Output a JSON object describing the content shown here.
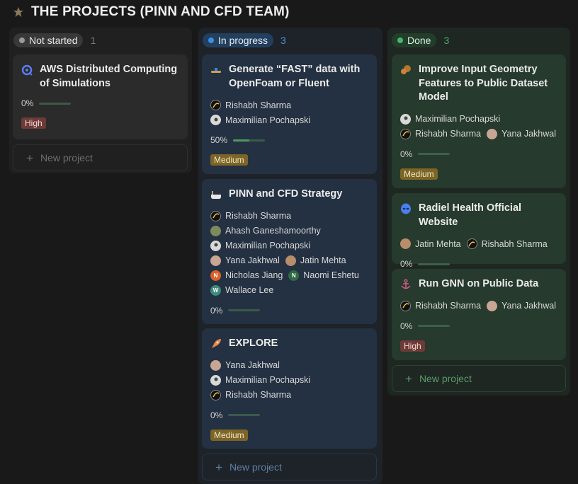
{
  "page": {
    "title": "THE PROJECTS (PINN AND CFD TEAM)"
  },
  "columns": {
    "not_started": {
      "label": "Not started",
      "count": "1",
      "cards": [
        {
          "title": "AWS Distributed Computing of Simulations",
          "icon": "gear-icon",
          "progress": "0%",
          "progress_fraction": 0,
          "priority": "High"
        }
      ],
      "new_label": "New project"
    },
    "in_progress": {
      "label": "In progress",
      "count": "3",
      "cards": [
        {
          "title": "Generate “FAST” data with OpenFoam or Fluent",
          "icon": "hammer-icon",
          "people": [
            "Rishabh Sharma",
            "Maximilian Pochapski"
          ],
          "progress": "50%",
          "progress_fraction": 0.5,
          "priority": "Medium"
        },
        {
          "title": "PINN and CFD Strategy",
          "icon": "bathtub-icon",
          "people": [
            "Rishabh Sharma",
            "Ahash Ganeshamoorthy",
            "Maximilian Pochapski",
            "Yana Jakhwal",
            "Jatin Mehta",
            "Nicholas Jiang",
            "Naomi Eshetu",
            "Wallace Lee"
          ],
          "initials": {
            "nj": "N",
            "ne": "N",
            "wl": "W"
          },
          "progress": "0%",
          "progress_fraction": 0
        },
        {
          "title": "EXPLORE",
          "icon": "rocket-icon",
          "people": [
            "Yana Jakhwal",
            "Maximilian Pochapski",
            "Rishabh Sharma"
          ],
          "progress": "0%",
          "progress_fraction": 0,
          "priority": "Medium"
        }
      ],
      "new_label": "New project"
    },
    "done": {
      "label": "Done",
      "count": "3",
      "cards": [
        {
          "title": "Improve Input Geometry Features to Public Dataset Model",
          "icon": "squirrel-icon",
          "people": [
            "Maximilian Pochapski",
            "Rishabh Sharma",
            "Yana Jakhwal"
          ],
          "progress": "0%",
          "progress_fraction": 0,
          "priority": "Medium"
        },
        {
          "title": "Radiel Health Official Website",
          "icon": "alien-icon",
          "people": [
            "Jatin Mehta",
            "Rishabh Sharma"
          ],
          "progress": "0%",
          "progress_fraction": 0
        },
        {
          "title": "Run GNN on Public Data",
          "icon": "anchor-icon",
          "people": [
            "Rishabh Sharma",
            "Yana Jakhwal"
          ],
          "progress": "0%",
          "progress_fraction": 0,
          "priority": "High"
        }
      ],
      "new_label": "New project"
    }
  },
  "colors": {
    "high": "#6e3a37",
    "medium": "#7c6526",
    "progress_fill": "#4c9a5f",
    "in_progress_accent": "#3a8fe0",
    "done_accent": "#4cb56c"
  }
}
